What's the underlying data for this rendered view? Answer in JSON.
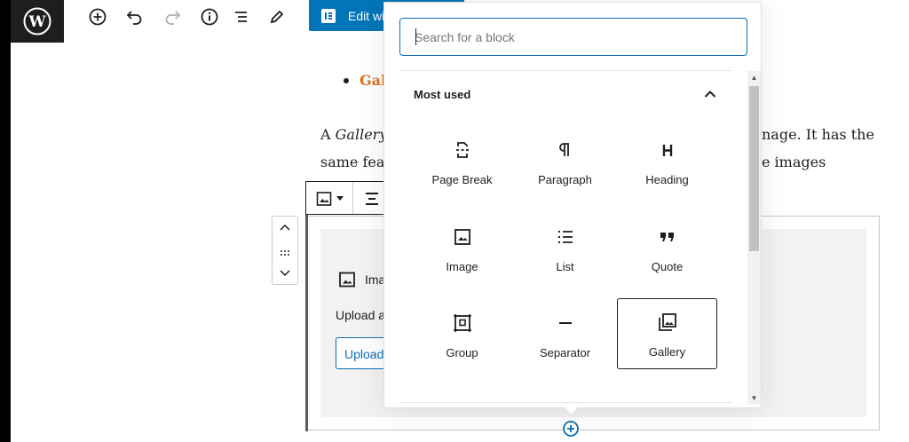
{
  "toolbar": {
    "edit_elementor_label": "Edit with Elementor",
    "edit_elementor_visible": "Edit wi"
  },
  "content": {
    "bullet_text": "Gal",
    "para_line1_prefix": "A ",
    "para_line1_em": "Gallery",
    "para_line1_suffix": "nage. It has the",
    "para_line2_prefix": "same fea",
    "para_line2_suffix": "e images"
  },
  "image_block": {
    "title_partial": "Ima",
    "instructions_partial": "Upload a",
    "upload_label": "Upload"
  },
  "inserter": {
    "search_placeholder": "Search for a block",
    "panel_title": "Most used",
    "blocks": [
      {
        "label": "Page Break",
        "icon": "page-break-icon"
      },
      {
        "label": "Paragraph",
        "icon": "paragraph-icon"
      },
      {
        "label": "Heading",
        "icon": "heading-icon"
      },
      {
        "label": "Image",
        "icon": "image-icon"
      },
      {
        "label": "List",
        "icon": "list-icon"
      },
      {
        "label": "Quote",
        "icon": "quote-icon"
      },
      {
        "label": "Group",
        "icon": "group-icon"
      },
      {
        "label": "Separator",
        "icon": "separator-icon"
      },
      {
        "label": "Gallery",
        "icon": "gallery-icon"
      }
    ],
    "selected_block": "Gallery"
  },
  "colors": {
    "accent": "#0a6fb4",
    "elementor_blue": "#0275b8",
    "link_orange": "#e06d1f",
    "dark": "#1e1e1e"
  }
}
